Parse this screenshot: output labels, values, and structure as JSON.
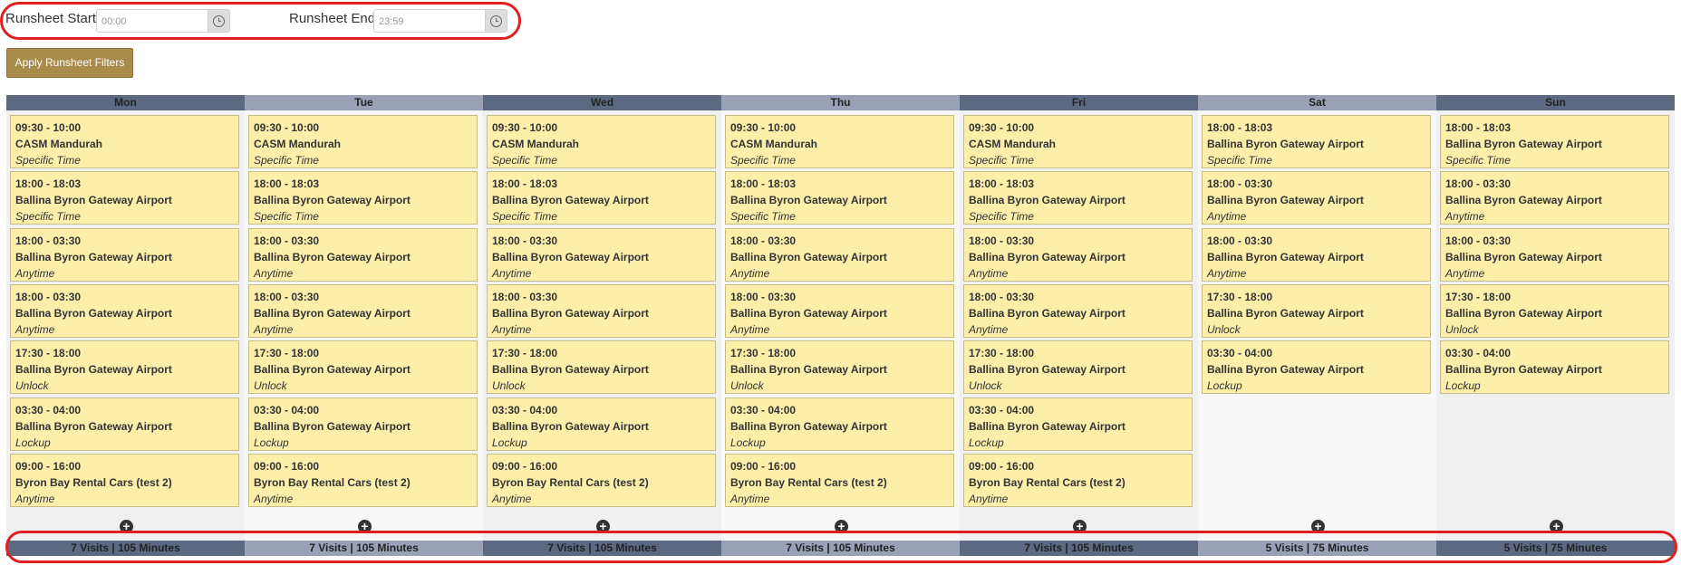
{
  "filters": {
    "start_label": "Runsheet Start",
    "start_value": "00:00",
    "end_label": "Runsheet End",
    "end_value": "23:59",
    "apply_label": "Apply Runsheet Filters"
  },
  "colors": {
    "header_dark": "#5d6883",
    "header_light": "#9aa1b7",
    "card_fill": "#fdeeaa",
    "button_gold": "#a98b4c",
    "highlight_red": "#e02020"
  },
  "days": [
    {
      "name": "Mon",
      "summary": "7 Visits | 105 Minutes",
      "visits": [
        {
          "time": "09:30 - 10:00",
          "site": "CASM Mandurah",
          "type": "Specific Time"
        },
        {
          "time": "18:00 - 18:03",
          "site": "Ballina Byron Gateway Airport",
          "type": "Specific Time"
        },
        {
          "time": "18:00 - 03:30",
          "site": "Ballina Byron Gateway Airport",
          "type": "Anytime"
        },
        {
          "time": "18:00 - 03:30",
          "site": "Ballina Byron Gateway Airport",
          "type": "Anytime"
        },
        {
          "time": "17:30 - 18:00",
          "site": "Ballina Byron Gateway Airport",
          "type": "Unlock"
        },
        {
          "time": "03:30 - 04:00",
          "site": "Ballina Byron Gateway Airport",
          "type": "Lockup"
        },
        {
          "time": "09:00 - 16:00",
          "site": "Byron Bay Rental Cars (test 2)",
          "type": "Anytime"
        }
      ]
    },
    {
      "name": "Tue",
      "summary": "7 Visits | 105 Minutes",
      "visits": [
        {
          "time": "09:30 - 10:00",
          "site": "CASM Mandurah",
          "type": "Specific Time"
        },
        {
          "time": "18:00 - 18:03",
          "site": "Ballina Byron Gateway Airport",
          "type": "Specific Time"
        },
        {
          "time": "18:00 - 03:30",
          "site": "Ballina Byron Gateway Airport",
          "type": "Anytime"
        },
        {
          "time": "18:00 - 03:30",
          "site": "Ballina Byron Gateway Airport",
          "type": "Anytime"
        },
        {
          "time": "17:30 - 18:00",
          "site": "Ballina Byron Gateway Airport",
          "type": "Unlock"
        },
        {
          "time": "03:30 - 04:00",
          "site": "Ballina Byron Gateway Airport",
          "type": "Lockup"
        },
        {
          "time": "09:00 - 16:00",
          "site": "Byron Bay Rental Cars (test 2)",
          "type": "Anytime"
        }
      ]
    },
    {
      "name": "Wed",
      "summary": "7 Visits | 105 Minutes",
      "visits": [
        {
          "time": "09:30 - 10:00",
          "site": "CASM Mandurah",
          "type": "Specific Time"
        },
        {
          "time": "18:00 - 18:03",
          "site": "Ballina Byron Gateway Airport",
          "type": "Specific Time"
        },
        {
          "time": "18:00 - 03:30",
          "site": "Ballina Byron Gateway Airport",
          "type": "Anytime"
        },
        {
          "time": "18:00 - 03:30",
          "site": "Ballina Byron Gateway Airport",
          "type": "Anytime"
        },
        {
          "time": "17:30 - 18:00",
          "site": "Ballina Byron Gateway Airport",
          "type": "Unlock"
        },
        {
          "time": "03:30 - 04:00",
          "site": "Ballina Byron Gateway Airport",
          "type": "Lockup"
        },
        {
          "time": "09:00 - 16:00",
          "site": "Byron Bay Rental Cars (test 2)",
          "type": "Anytime"
        }
      ]
    },
    {
      "name": "Thu",
      "summary": "7 Visits | 105 Minutes",
      "visits": [
        {
          "time": "09:30 - 10:00",
          "site": "CASM Mandurah",
          "type": "Specific Time"
        },
        {
          "time": "18:00 - 18:03",
          "site": "Ballina Byron Gateway Airport",
          "type": "Specific Time"
        },
        {
          "time": "18:00 - 03:30",
          "site": "Ballina Byron Gateway Airport",
          "type": "Anytime"
        },
        {
          "time": "18:00 - 03:30",
          "site": "Ballina Byron Gateway Airport",
          "type": "Anytime"
        },
        {
          "time": "17:30 - 18:00",
          "site": "Ballina Byron Gateway Airport",
          "type": "Unlock"
        },
        {
          "time": "03:30 - 04:00",
          "site": "Ballina Byron Gateway Airport",
          "type": "Lockup"
        },
        {
          "time": "09:00 - 16:00",
          "site": "Byron Bay Rental Cars (test 2)",
          "type": "Anytime"
        }
      ]
    },
    {
      "name": "Fri",
      "summary": "7 Visits | 105 Minutes",
      "visits": [
        {
          "time": "09:30 - 10:00",
          "site": "CASM Mandurah",
          "type": "Specific Time"
        },
        {
          "time": "18:00 - 18:03",
          "site": "Ballina Byron Gateway Airport",
          "type": "Specific Time"
        },
        {
          "time": "18:00 - 03:30",
          "site": "Ballina Byron Gateway Airport",
          "type": "Anytime"
        },
        {
          "time": "18:00 - 03:30",
          "site": "Ballina Byron Gateway Airport",
          "type": "Anytime"
        },
        {
          "time": "17:30 - 18:00",
          "site": "Ballina Byron Gateway Airport",
          "type": "Unlock"
        },
        {
          "time": "03:30 - 04:00",
          "site": "Ballina Byron Gateway Airport",
          "type": "Lockup"
        },
        {
          "time": "09:00 - 16:00",
          "site": "Byron Bay Rental Cars (test 2)",
          "type": "Anytime"
        }
      ]
    },
    {
      "name": "Sat",
      "summary": "5 Visits | 75 Minutes",
      "visits": [
        {
          "time": "18:00 - 18:03",
          "site": "Ballina Byron Gateway Airport",
          "type": "Specific Time"
        },
        {
          "time": "18:00 - 03:30",
          "site": "Ballina Byron Gateway Airport",
          "type": "Anytime"
        },
        {
          "time": "18:00 - 03:30",
          "site": "Ballina Byron Gateway Airport",
          "type": "Anytime"
        },
        {
          "time": "17:30 - 18:00",
          "site": "Ballina Byron Gateway Airport",
          "type": "Unlock"
        },
        {
          "time": "03:30 - 04:00",
          "site": "Ballina Byron Gateway Airport",
          "type": "Lockup"
        }
      ]
    },
    {
      "name": "Sun",
      "summary": "5 Visits | 75 Minutes",
      "visits": [
        {
          "time": "18:00 - 18:03",
          "site": "Ballina Byron Gateway Airport",
          "type": "Specific Time"
        },
        {
          "time": "18:00 - 03:30",
          "site": "Ballina Byron Gateway Airport",
          "type": "Anytime"
        },
        {
          "time": "18:00 - 03:30",
          "site": "Ballina Byron Gateway Airport",
          "type": "Anytime"
        },
        {
          "time": "17:30 - 18:00",
          "site": "Ballina Byron Gateway Airport",
          "type": "Unlock"
        },
        {
          "time": "03:30 - 04:00",
          "site": "Ballina Byron Gateway Airport",
          "type": "Lockup"
        }
      ]
    }
  ]
}
